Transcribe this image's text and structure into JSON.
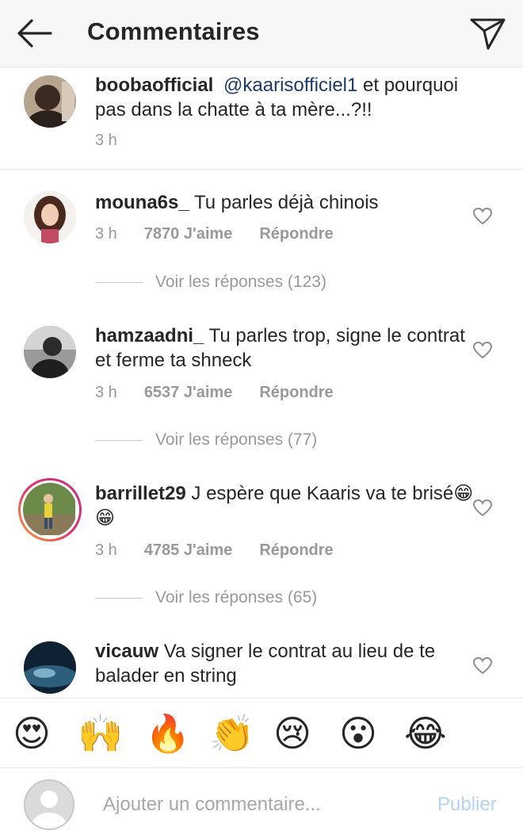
{
  "header": {
    "title": "Commentaires",
    "back_icon": "back-arrow-icon",
    "send_icon": "paper-plane-icon"
  },
  "comments": [
    {
      "username": "boobaofficial",
      "mention": "@kaarisofficiel1",
      "text": " et pourquoi pas dans la chatte à ta mère...?!!",
      "time": "3 h"
    },
    {
      "username": "mouna6s_",
      "text": " Tu parles déjà chinois",
      "time": "3 h",
      "likes": "7870 J'aime",
      "reply": "Répondre",
      "view_replies": "Voir les réponses (123)"
    },
    {
      "username": "hamzaadni_",
      "text": " Tu parles trop, signe le contrat et ferme ta shneck",
      "time": "3 h",
      "likes": "6537 J'aime",
      "reply": "Répondre",
      "view_replies": "Voir les réponses (77)"
    },
    {
      "username": "barrillet29",
      "text": " J espère que Kaaris va te brisé😁😁",
      "time": "3 h",
      "likes": "4785 J'aime",
      "reply": "Répondre",
      "view_replies": "Voir les réponses (65)"
    },
    {
      "username": "vicauw",
      "text": " Va signer le contrat au lieu de te balader en string"
    }
  ],
  "emoji_bar": [
    "😍",
    "🙌",
    "🔥",
    "👏",
    "😢",
    "😮",
    "😂"
  ],
  "composer": {
    "placeholder": "Ajouter un commentaire...",
    "publish_label": "Publier"
  },
  "colors": {
    "mention": "#1c3a6b",
    "meta_gray": "#999999",
    "publish_disabled": "#b3d3f5"
  }
}
